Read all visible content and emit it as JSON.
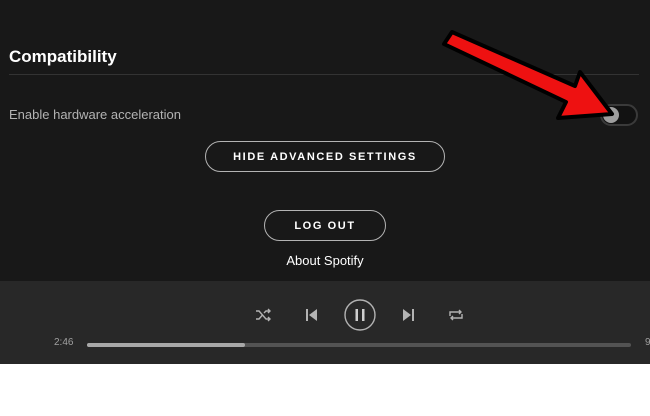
{
  "settings": {
    "section_title": "Compatibility",
    "hardware_acceleration_label": "Enable hardware acceleration",
    "hardware_acceleration_enabled": false,
    "hide_advanced_label": "HIDE ADVANCED SETTINGS",
    "logout_label": "LOG OUT",
    "about_label": "About Spotify"
  },
  "player": {
    "current_time": "2:46",
    "total_time": "9",
    "progress": 0.29,
    "controls": [
      "shuffle-icon",
      "previous-icon",
      "pause-icon",
      "next-icon",
      "repeat-icon"
    ]
  },
  "annotation": {
    "arrow_color": "#ee1111",
    "arrow_outline": "#000000"
  }
}
